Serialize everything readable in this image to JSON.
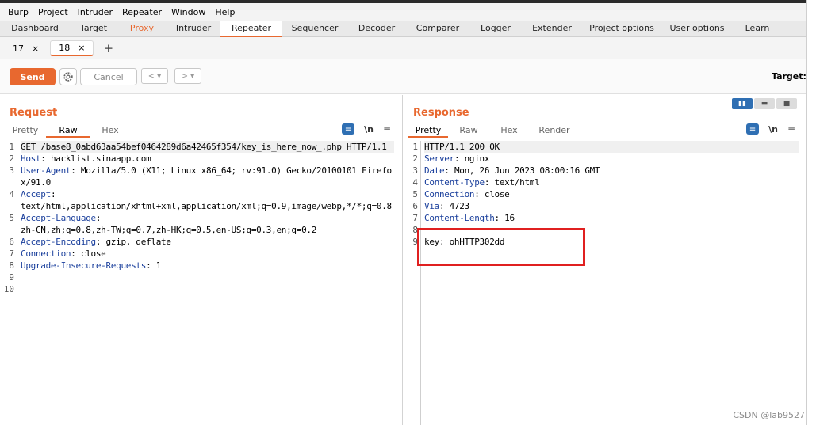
{
  "menu": [
    "Burp",
    "Project",
    "Intruder",
    "Repeater",
    "Window",
    "Help"
  ],
  "main_tabs": [
    "Dashboard",
    "Target",
    "Proxy",
    "Intruder",
    "Repeater",
    "Sequencer",
    "Decoder",
    "Comparer",
    "Logger",
    "Extender",
    "Project options",
    "User options",
    "Learn"
  ],
  "sub_tabs": [
    {
      "label": "17",
      "close": "×"
    },
    {
      "label": "18",
      "close": "×"
    }
  ],
  "add_tab": "+",
  "toolbar": {
    "send": "Send",
    "cancel": "Cancel",
    "back": "<",
    "forward": ">",
    "dropdown": "▾",
    "target": "Target: h"
  },
  "request": {
    "title": "Request",
    "tabs": [
      "Pretty",
      "Raw",
      "Hex"
    ],
    "lines": [
      {
        "n": "1",
        "parts": [
          {
            "t": "GET /base8_0abd63aa54bef0464289d6a42465f354/key_is_here_now_.php HTTP/1.1"
          }
        ]
      },
      {
        "n": "2",
        "parts": [
          {
            "t": "Host",
            "k": true
          },
          {
            "t": ": hacklist.sinaapp.com"
          }
        ]
      },
      {
        "n": "3",
        "parts": [
          {
            "t": "User-Agent",
            "k": true
          },
          {
            "t": ": Mozilla/5.0 (X11; Linux x86_64; rv:91.0) Gecko/20100101 Firefox/91.0"
          }
        ]
      },
      {
        "n": "4",
        "parts": [
          {
            "t": "Accept",
            "k": true
          },
          {
            "t": ":\ntext/html,application/xhtml+xml,application/xml;q=0.9,image/webp,*/*;q=0.8"
          }
        ]
      },
      {
        "n": "5",
        "parts": [
          {
            "t": "Accept-Language",
            "k": true
          },
          {
            "t": ":\nzh-CN,zh;q=0.8,zh-TW;q=0.7,zh-HK;q=0.5,en-US;q=0.3,en;q=0.2"
          }
        ]
      },
      {
        "n": "6",
        "parts": [
          {
            "t": "Accept-Encoding",
            "k": true
          },
          {
            "t": ": gzip, deflate"
          }
        ]
      },
      {
        "n": "7",
        "parts": [
          {
            "t": "Connection",
            "k": true
          },
          {
            "t": ": close"
          }
        ]
      },
      {
        "n": "8",
        "parts": [
          {
            "t": "Upgrade-Insecure-Requests",
            "k": true
          },
          {
            "t": ": 1"
          }
        ]
      },
      {
        "n": "9",
        "parts": [
          {
            "t": ""
          }
        ]
      },
      {
        "n": "10",
        "parts": [
          {
            "t": ""
          }
        ]
      }
    ]
  },
  "response": {
    "title": "Response",
    "tabs": [
      "Pretty",
      "Raw",
      "Hex",
      "Render"
    ],
    "lines": [
      {
        "n": "1",
        "parts": [
          {
            "t": "HTTP/1.1 200 OK"
          }
        ]
      },
      {
        "n": "2",
        "parts": [
          {
            "t": "Server",
            "k": true
          },
          {
            "t": ": nginx"
          }
        ]
      },
      {
        "n": "3",
        "parts": [
          {
            "t": "Date",
            "k": true
          },
          {
            "t": ": Mon, 26 Jun 2023 08:00:16 GMT"
          }
        ]
      },
      {
        "n": "4",
        "parts": [
          {
            "t": "Content-Type",
            "k": true
          },
          {
            "t": ": text/html"
          }
        ]
      },
      {
        "n": "5",
        "parts": [
          {
            "t": "Connection",
            "k": true
          },
          {
            "t": ": close"
          }
        ]
      },
      {
        "n": "6",
        "parts": [
          {
            "t": "Via",
            "k": true
          },
          {
            "t": ": 4723"
          }
        ]
      },
      {
        "n": "7",
        "parts": [
          {
            "t": "Content-Length",
            "k": true
          },
          {
            "t": ": 16"
          }
        ]
      },
      {
        "n": "8",
        "parts": [
          {
            "t": ""
          }
        ]
      },
      {
        "n": "9",
        "parts": [
          {
            "t": "key: ohHTTP302dd"
          }
        ]
      }
    ]
  },
  "watermark": "CSDN @lab9527",
  "colors": {
    "accent": "#e8682f",
    "header_key": "#1a3f9c",
    "highlight_box": "#e02020",
    "toggle_blue": "#2f6fb3"
  }
}
